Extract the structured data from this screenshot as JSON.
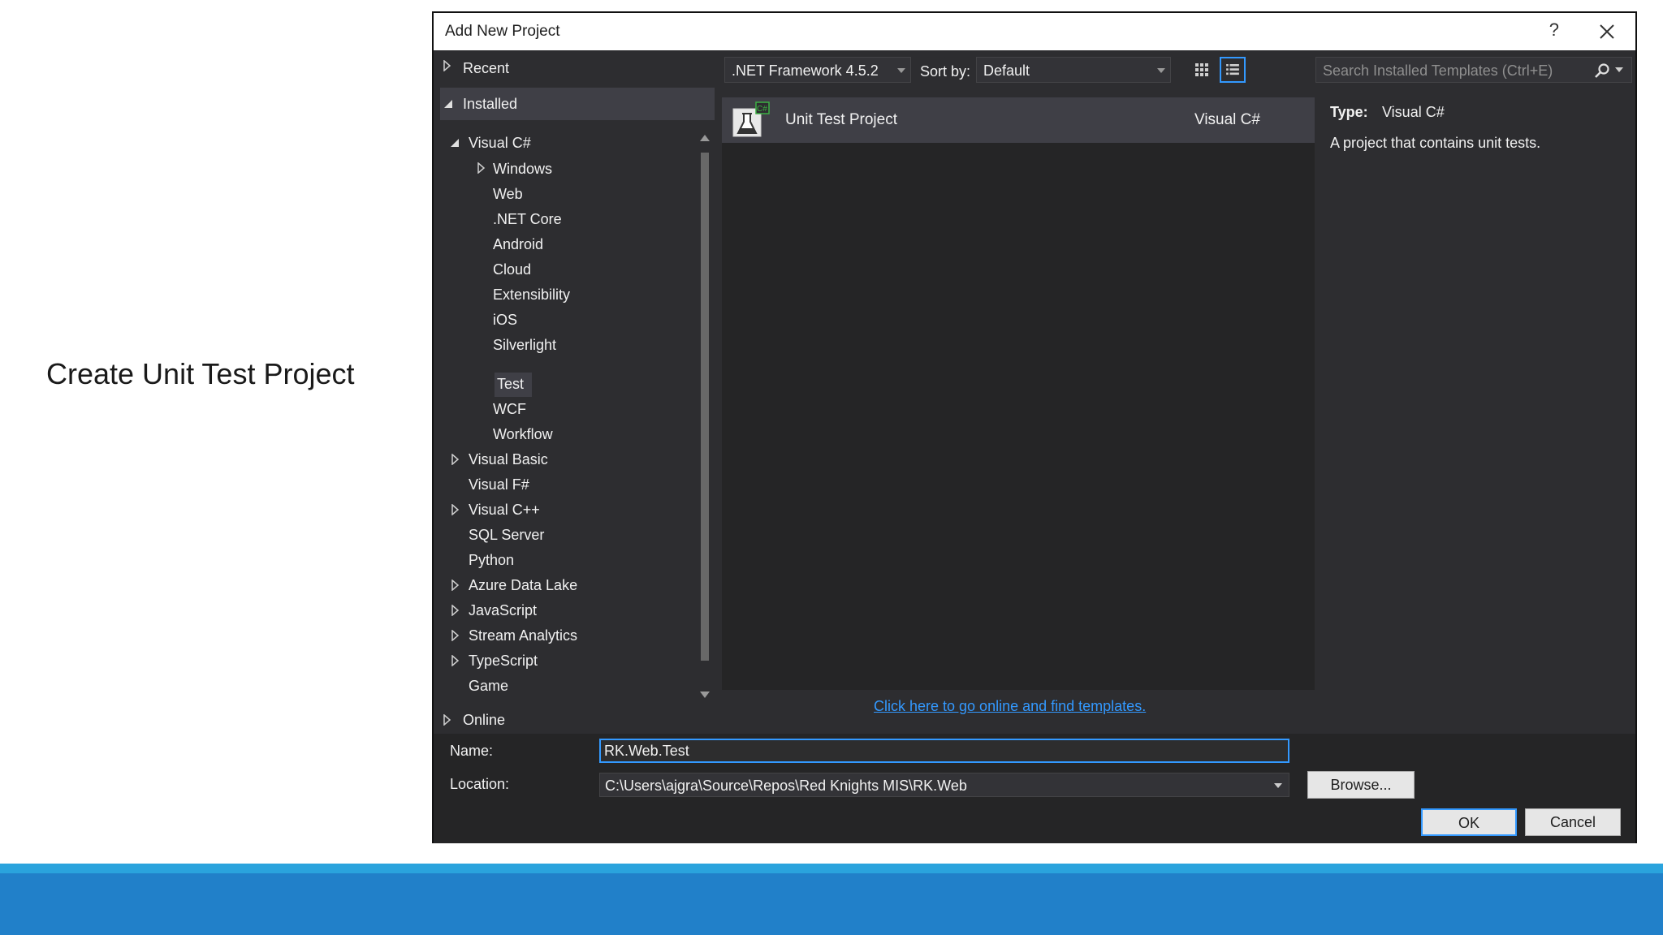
{
  "slide": {
    "title": "Create Unit Test Project"
  },
  "dialog": {
    "title": "Add New Project",
    "help_label": "?",
    "tree": {
      "recent": "Recent",
      "installed": "Installed",
      "visual_csharp": "Visual C#",
      "csharp_children": [
        "Windows",
        "Web",
        ".NET Core",
        "Android",
        "Cloud",
        "Extensibility",
        "iOS",
        "Silverlight",
        "Test",
        "WCF",
        "Workflow"
      ],
      "languages": [
        "Visual Basic",
        "Visual F#",
        "Visual C++",
        "SQL Server",
        "Python",
        "Azure Data Lake",
        "JavaScript",
        "Stream Analytics",
        "TypeScript",
        "Game"
      ],
      "online": "Online"
    },
    "toolbar": {
      "framework": ".NET Framework 4.5.2",
      "sort_label": "Sort by:",
      "sort_value": "Default",
      "search_placeholder": "Search Installed Templates (Ctrl+E)"
    },
    "templates": [
      {
        "name": "Unit Test Project",
        "language": "Visual C#"
      }
    ],
    "details": {
      "type_label": "Type:",
      "type_value": "Visual C#",
      "description": "A project that contains unit tests."
    },
    "online_link": "Click here to go online and find templates.",
    "form": {
      "name_label": "Name:",
      "name_value": "RK.Web.Test",
      "location_label": "Location:",
      "location_value": "C:\\Users\\ajgra\\Source\\Repos\\Red Knights MIS\\RK.Web",
      "browse": "Browse...",
      "ok": "OK",
      "cancel": "Cancel"
    },
    "colors": {
      "accent": "#3399ff",
      "background": "#2d2d30",
      "list_bg": "#252526",
      "selected": "#3f3f46",
      "slide_band": "#2180c9"
    }
  }
}
